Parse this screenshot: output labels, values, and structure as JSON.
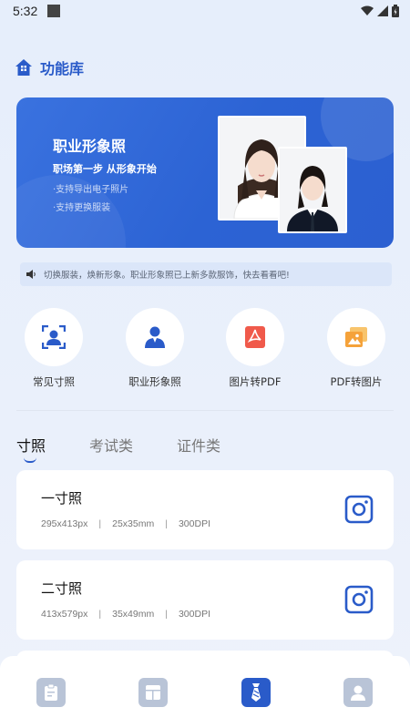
{
  "status_bar": {
    "time": "5:32"
  },
  "header": {
    "title": "功能库",
    "icon": "home-icon"
  },
  "banner": {
    "title": "职业形象照",
    "subtitle": "职场第一步 从形象开始",
    "bullets": [
      "·支持导出电子照片",
      "·支持更换服装"
    ]
  },
  "notice": {
    "text": "切换服装，焕新形象。职业形象照已上新多款服饰，快去看看吧!",
    "icon": "speaker-icon"
  },
  "features": [
    {
      "label": "常见寸照",
      "icon": "portrait-scan-icon"
    },
    {
      "label": "职业形象照",
      "icon": "person-suit-icon"
    },
    {
      "label": "图片转PDF",
      "icon": "pdf-icon"
    },
    {
      "label": "PDF转图片",
      "icon": "image-stack-icon"
    }
  ],
  "tabs": [
    "寸照",
    "考试类",
    "证件类"
  ],
  "active_tab": "寸照",
  "cards": [
    {
      "title": "一寸照",
      "px": "295x413px",
      "mm": "25x35mm",
      "dpi": "300DPI"
    },
    {
      "title": "二寸照",
      "px": "413x579px",
      "mm": "35x49mm",
      "dpi": "300DPI"
    }
  ],
  "bottom_nav": [
    {
      "icon": "clipboard-icon",
      "active": false
    },
    {
      "icon": "layout-icon",
      "active": false
    },
    {
      "icon": "tie-icon",
      "active": true
    },
    {
      "icon": "profile-icon",
      "active": false
    }
  ],
  "colors": {
    "accent": "#2a5bc9",
    "banner": "#2c63d4",
    "pdf_red": "#f05a4b",
    "orange": "#f5a23a"
  }
}
